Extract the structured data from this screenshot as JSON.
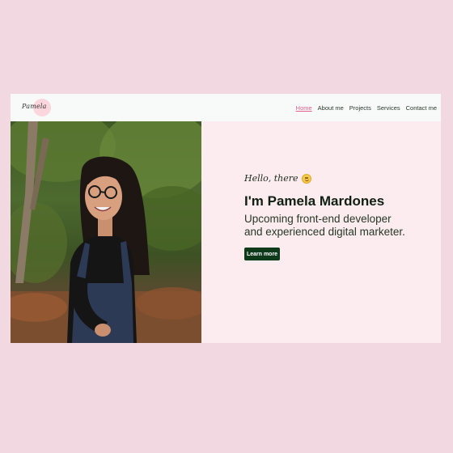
{
  "nav": {
    "logo_text": "Pamela",
    "links": [
      {
        "label": "Home"
      },
      {
        "label": "About me"
      },
      {
        "label": "Projects"
      },
      {
        "label": "Services"
      },
      {
        "label": "Contact me"
      }
    ],
    "active_color": "#e15f8a"
  },
  "hero": {
    "greeting": "Hello, there",
    "greeting_icon": "smiley-face-icon",
    "title": "I'm Pamela Mardones",
    "subtitle_line1": "Upcoming front-end developer",
    "subtitle_line2": "and experienced digital marketer.",
    "button_label": "Learn more",
    "button_color": "#0f3a1a",
    "photo": "portrait-photo"
  },
  "colors": {
    "page_background": "#f2d8e1",
    "site_background": "#fdecef",
    "navbar_background": "#f8fafa"
  }
}
